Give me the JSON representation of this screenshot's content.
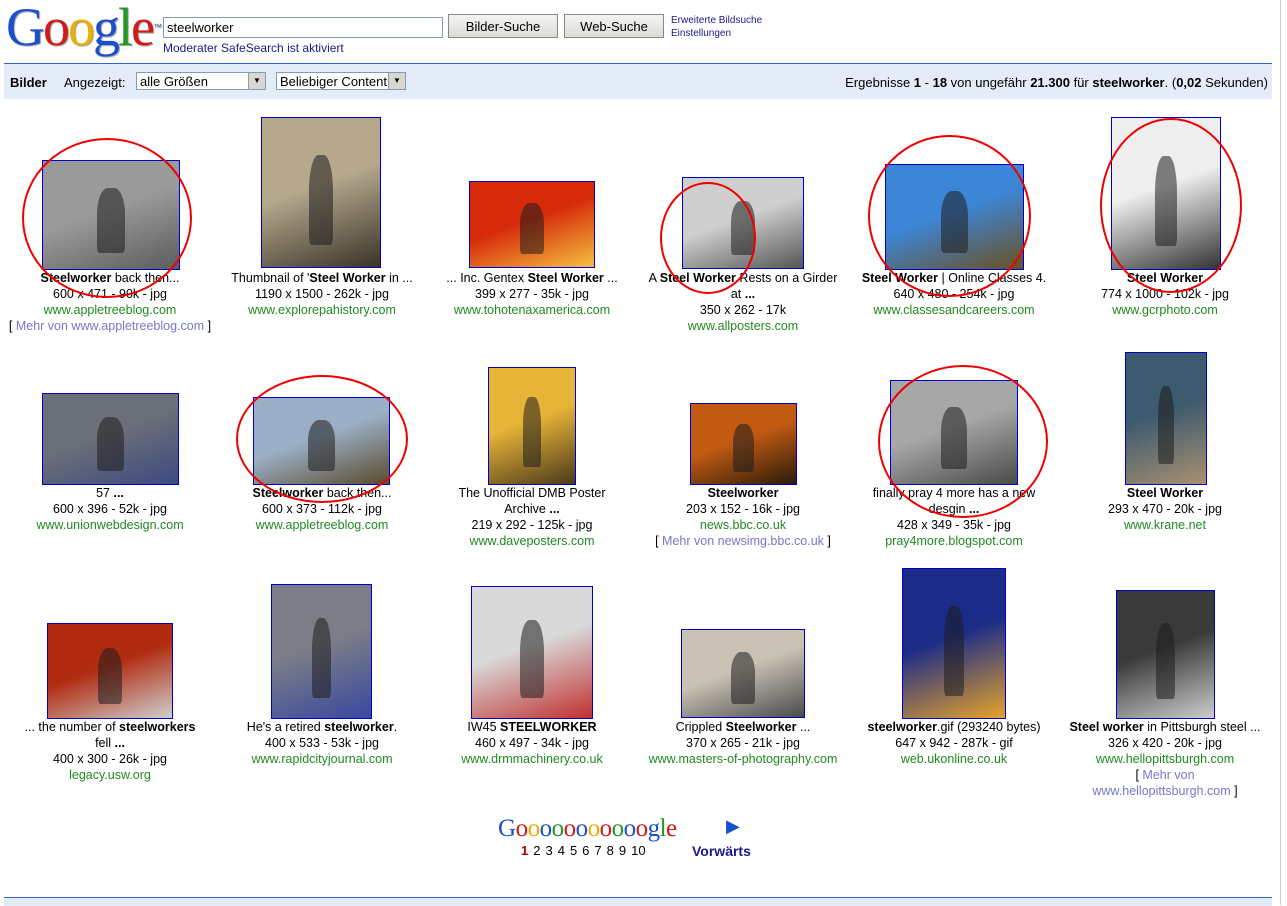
{
  "header": {
    "logo_letters": [
      "G",
      "o",
      "o",
      "g",
      "l",
      "e"
    ],
    "logo_colors": [
      "#1a4fcf",
      "#d11a1a",
      "#e8b000",
      "#1a4fcf",
      "#229922",
      "#d11a1a"
    ],
    "search_value": "steelworker",
    "image_search_button": "Bilder-Suche",
    "web_search_button": "Web-Suche",
    "advanced_link": "Erweiterte Bildsuche",
    "settings_link": "Einstellungen",
    "safesearch_text": "Moderater SafeSearch ist aktiviert"
  },
  "bar": {
    "section_label": "Bilder",
    "shown_label": "Angezeigt:",
    "size_select": "alle Größen",
    "content_select": "Beliebiger Content",
    "results_prefix": "Ergebnisse ",
    "results_from": "1",
    "results_dash": " - ",
    "results_to": "18",
    "results_mid": " von ungefähr ",
    "results_total": "21.300",
    "results_for": " für ",
    "results_query": "steelworker",
    "results_time_prefix": ". (",
    "results_time": "0,02",
    "results_time_suffix": " Sekunden)"
  },
  "results": [
    {
      "cap_pre": "",
      "cap_bold": "Steelworker",
      "cap_post": " back then...",
      "cap2": "",
      "meta": "600 x 471 - 90k - jpg",
      "url": "www.appletreeblog.com",
      "more": "Mehr von www.appletreeblog.com"
    },
    {
      "cap_pre": "Thumbnail of '",
      "cap_bold": "Steel Worker",
      "cap_post": " in ...",
      "cap2": "",
      "meta": "1190 x 1500 - 262k - jpg",
      "url": "www.explorepahistory.com",
      "more": ""
    },
    {
      "cap_pre": "... Inc. Gentex ",
      "cap_bold": "Steel Worker",
      "cap_post": " ...",
      "cap2": "",
      "meta": "399 x 277 - 35k - jpg",
      "url": "www.tohotenaxamerica.com",
      "more": ""
    },
    {
      "cap_pre": "A ",
      "cap_bold": "Steel Worker",
      "cap_post": " Rests on a Girder",
      "cap2": "at ...",
      "meta": "350 x 262 - 17k",
      "url": "www.allposters.com",
      "more": ""
    },
    {
      "cap_pre": "",
      "cap_bold": "Steel Worker",
      "cap_post": " | Online Classes 4.",
      "cap2": "",
      "meta": "640 x 480 - 254k - jpg",
      "url": "www.classesandcareers.com",
      "more": ""
    },
    {
      "cap_pre": "",
      "cap_bold": "Steel Worker",
      "cap_post": "",
      "cap2": "",
      "meta": "774 x 1000 - 102k - jpg",
      "url": "www.gcrphoto.com",
      "more": ""
    },
    {
      "cap_pre": "57 ",
      "cap_bold": "...",
      "cap_post": "",
      "cap2": "",
      "meta": "600 x 396 - 52k - jpg",
      "url": "www.unionwebdesign.com",
      "more": ""
    },
    {
      "cap_pre": "",
      "cap_bold": "Steelworker",
      "cap_post": " back then...",
      "cap2": "",
      "meta": "600 x 373 - 112k - jpg",
      "url": "www.appletreeblog.com",
      "more": ""
    },
    {
      "cap_pre": "The Unofficial DMB Poster",
      "cap_bold": "",
      "cap_post": "",
      "cap2": "Archive ...",
      "meta": "219 x 292 - 125k - jpg",
      "url": "www.daveposters.com",
      "more": ""
    },
    {
      "cap_pre": "",
      "cap_bold": "Steelworker",
      "cap_post": "",
      "cap2": "",
      "meta": "203 x 152 - 16k - jpg",
      "url": "news.bbc.co.uk",
      "more": "Mehr von newsimg.bbc.co.uk"
    },
    {
      "cap_pre": "finally pray 4 more has a new",
      "cap_bold": "",
      "cap_post": "",
      "cap2": "desgin ...",
      "meta": "428 x 349 - 35k - jpg",
      "url": "pray4more.blogspot.com",
      "more": ""
    },
    {
      "cap_pre": "",
      "cap_bold": "Steel Worker",
      "cap_post": "",
      "cap2": "",
      "meta": "293 x 470 - 20k - jpg",
      "url": "www.krane.net",
      "more": ""
    },
    {
      "cap_pre": "... the number of ",
      "cap_bold": "steelworkers",
      "cap_post": "",
      "cap2": "fell ...",
      "meta": "400 x 300 - 26k - jpg",
      "url": "legacy.usw.org",
      "more": ""
    },
    {
      "cap_pre": "He's a retired ",
      "cap_bold": "steelworker",
      "cap_post": ".",
      "cap2": "",
      "meta": "400 x 533 - 53k - jpg",
      "url": "www.rapidcityjournal.com",
      "more": ""
    },
    {
      "cap_pre": "IW45 ",
      "cap_bold": "STEELWORKER",
      "cap_post": "",
      "cap2": "",
      "meta": "460 x 497 - 34k - jpg",
      "url": "www.drmmachinery.co.uk",
      "more": ""
    },
    {
      "cap_pre": "Crippled ",
      "cap_bold": "Steelworker",
      "cap_post": " ...",
      "cap2": "",
      "meta": "370 x 265 - 21k - jpg",
      "url": "www.masters-of-photography.com",
      "more": ""
    },
    {
      "cap_pre": "",
      "cap_bold": "steelworker",
      "cap_post": ".gif (293240 bytes)",
      "cap2": "",
      "meta": "647 x 942 - 287k - gif",
      "url": "web.ukonline.co.uk",
      "more": ""
    },
    {
      "cap_pre": "",
      "cap_bold": "Steel worker",
      "cap_post": " in Pittsburgh steel ...",
      "cap2": "",
      "meta": "326 x 420 - 20k - jpg",
      "url": "www.hellopittsburgh.com",
      "more": "Mehr von www.hellopittsburgh.com"
    }
  ],
  "thumb_icons": [
    "skyscraper-worker-photo",
    "silhouette-worker-photo",
    "molten-steel-photo",
    "girder-rest-photo",
    "blue-sky-worker-photo",
    "frame-structure-photo",
    "union-worker-photo",
    "beam-workers-photo",
    "dmb-poster-image",
    "sparks-worker-photo",
    "city-view-worker-photo",
    "painted-worker-image",
    "hardhat-worker-photo",
    "bandana-man-photo",
    "machine-photo",
    "crippled-worker-photo",
    "face-mural-photo",
    "pittsburgh-man-photo"
  ],
  "pager": {
    "letters": [
      "G",
      "o",
      "o",
      "o",
      "o",
      "o",
      "o",
      "o",
      "o",
      "o",
      "o",
      "o",
      "g",
      "l",
      "e"
    ],
    "colors": [
      "#1a4fcf",
      "#d11a1a",
      "#e8b000",
      "#1a4fcf",
      "#229922",
      "#d11a1a",
      "#1a4fcf",
      "#e8b000",
      "#d11a1a",
      "#229922",
      "#1a4fcf",
      "#d11a1a",
      "#1a4fcf",
      "#229922",
      "#d11a1a"
    ],
    "pages": [
      "1",
      "2",
      "3",
      "4",
      "5",
      "6",
      "7",
      "8",
      "9",
      "10"
    ],
    "next_label": "Vorwärts"
  }
}
